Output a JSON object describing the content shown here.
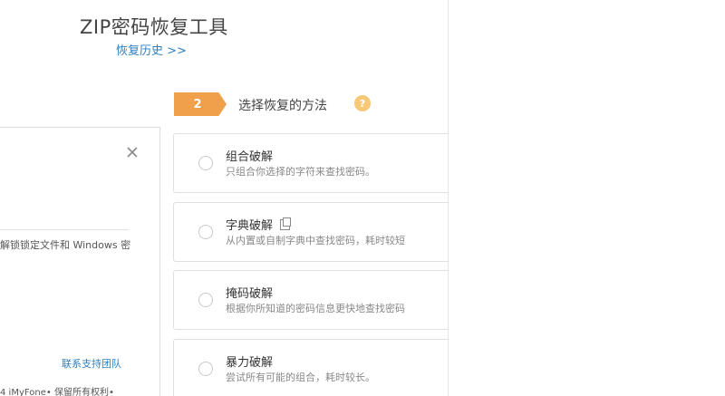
{
  "header": {
    "title": "ZIP密码恢复工具",
    "history_link": "恢复历史 >>"
  },
  "dialog": {
    "close_icon": "close-icon",
    "text": "解锁锁定文件和 Windows 密",
    "support_link": "联系支持团队",
    "copyright": "4 iMyFone• 保留所有权利•"
  },
  "step": {
    "number": "2",
    "title": "选择恢复的方法",
    "help_icon": "help-icon",
    "accent_color": "#f0a04a"
  },
  "methods": [
    {
      "name": "组合破解",
      "desc": "只组合你选择的字符来查找密码。"
    },
    {
      "name": "字典破解",
      "desc": "从内置或自制字典中查找密码，耗时较短",
      "icon": "copy-icon"
    },
    {
      "name": "掩码破解",
      "desc": "根据你所知道的密码信息更快地查找密码"
    },
    {
      "name": "暴力破解",
      "desc": "尝试所有可能的组合，耗时较长。"
    }
  ]
}
